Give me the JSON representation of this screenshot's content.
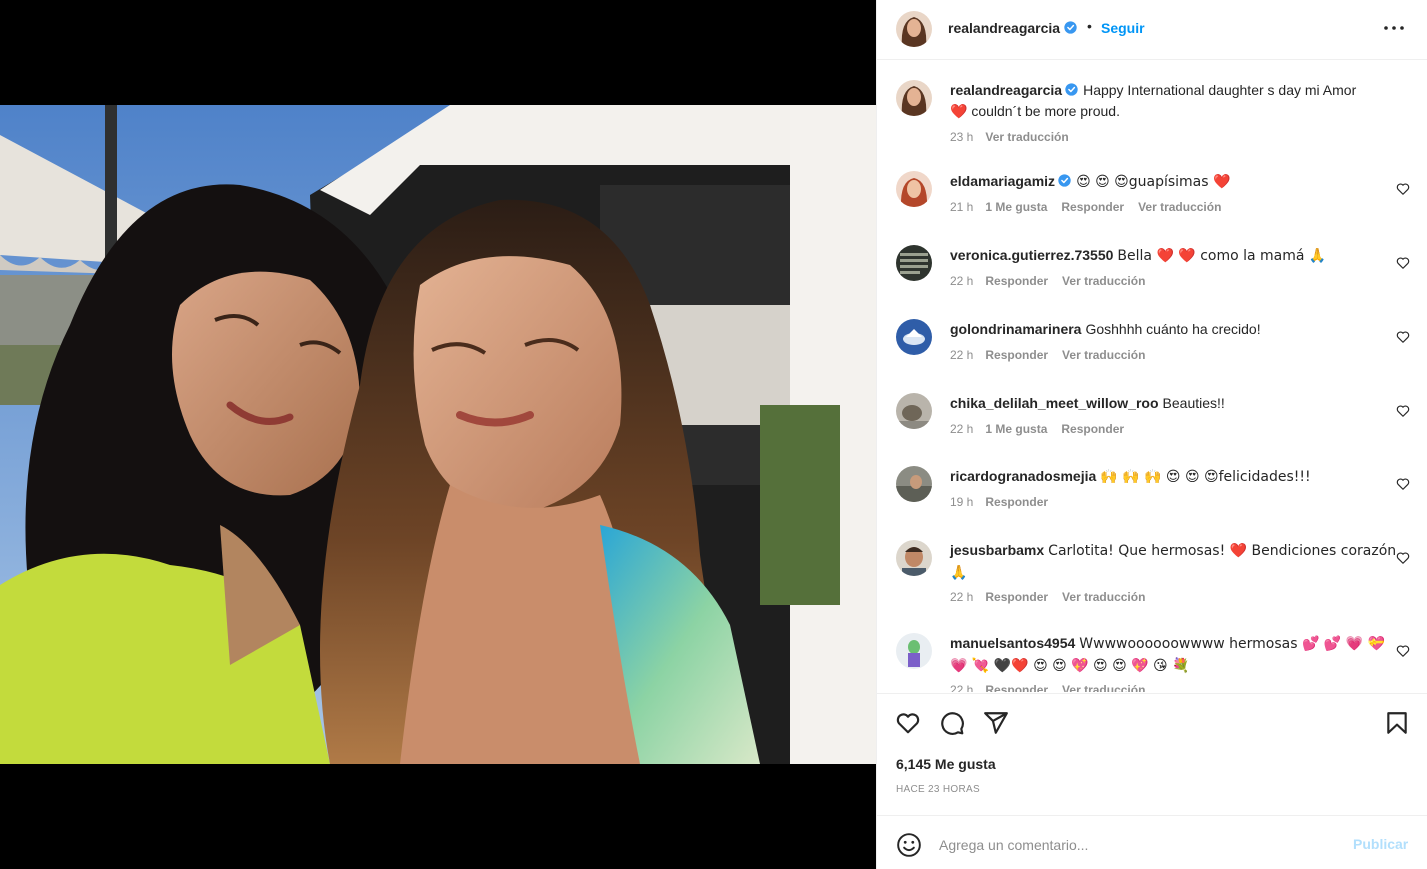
{
  "post": {
    "author": "realandreagarcia",
    "follow_label": "Seguir",
    "separator": "•",
    "caption_text": "Happy International daughter s day mi Amor",
    "caption_emoji": "❤️",
    "caption_rest": "couldn´t be more proud.",
    "caption_time": "23 h",
    "caption_translate": "Ver traducción",
    "likes": "6,145 Me gusta",
    "ago": "HACE 23 HORAS"
  },
  "comments": [
    {
      "user": "eldamariagamiz",
      "verified": true,
      "text": "😍 😍 😍guapísimas ❤️",
      "time": "21 h",
      "likes": "1 Me gusta",
      "reply": "Responder",
      "translate": "Ver traducción"
    },
    {
      "user": "veronica.gutierrez.73550",
      "text": "Bella ❤️ ❤️  como la mamá 🙏",
      "time": "22 h",
      "reply": "Responder",
      "translate": "Ver traducción"
    },
    {
      "user": "golondrinamarinera",
      "text": "Goshhhh cuánto ha crecido!",
      "time": "22 h",
      "reply": "Responder",
      "translate": "Ver traducción"
    },
    {
      "user": "chika_delilah_meet_willow_roo",
      "text": "Beauties!!",
      "time": "22 h",
      "likes": "1 Me gusta",
      "reply": "Responder"
    },
    {
      "user": "ricardogranadosmejia",
      "text": "🙌 🙌 🙌 😍 😍 😍felicidades!!!",
      "time": "19 h",
      "reply": "Responder"
    },
    {
      "user": "jesusbarbamx",
      "text": "Carlotita! Que hermosas! ❤️  Bendiciones corazón 🙏",
      "time": "22 h",
      "reply": "Responder",
      "translate": "Ver traducción"
    },
    {
      "user": "manuelsantos4954",
      "text": "Wwwwoooooowwww hermosas 💕 💕 💗 💝 💗 💘 🖤❤️ 😍 😍 💖 😍 😍 💖 😘 💐",
      "time": "22 h",
      "reply": "Responder",
      "translate": "Ver traducción"
    }
  ],
  "add_comment": {
    "placeholder": "Agrega un comentario...",
    "publish": "Publicar"
  },
  "icons": [
    "verified-badge-icon",
    "more-options-icon",
    "heart-icon",
    "comment-icon",
    "share-icon",
    "bookmark-icon",
    "emoji-icon"
  ],
  "colors": {
    "accent": "#0095f6",
    "verified": "#3897f0",
    "muted": "#8e8e8e",
    "like_red": "#ed4956",
    "publish_disabled": "#b2dffc"
  }
}
